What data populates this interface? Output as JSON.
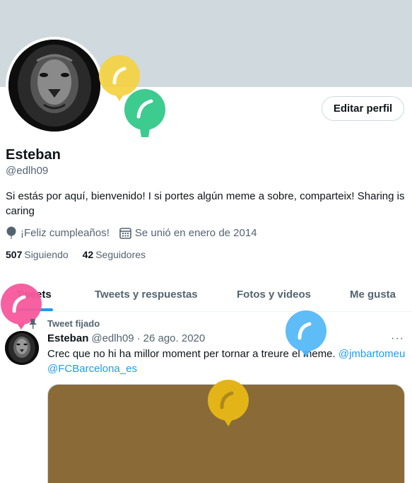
{
  "profile": {
    "name": "Esteban",
    "handle": "@edlh09",
    "bio": "Si estás por aquí, bienvenido! I si portes algún meme a sobre, comparteix! Sharing is caring",
    "birthday": "¡Feliz cumpleaños!",
    "joined": "Se unió en enero de 2014",
    "following_count": "507",
    "following_label": "Siguiendo",
    "followers_count": "42",
    "followers_label": "Seguidores",
    "edit_label": "Editar perfil"
  },
  "tabs": [
    {
      "label": "Tweets",
      "active": true
    },
    {
      "label": "Tweets y respuestas",
      "active": false
    },
    {
      "label": "Fotos y videos",
      "active": false
    },
    {
      "label": "Me gusta",
      "active": false
    }
  ],
  "tweet": {
    "pinned_label": "Tweet fijado",
    "name": "Esteban",
    "handle": "@edlh09",
    "separator": "·",
    "date": "26 ago. 2020",
    "more": "···",
    "text": "Crec que no hi ha millor moment per tornar a treure el meme.",
    "mention1": "@jmbartomeu",
    "mention2": "@FCBarcelona_es"
  },
  "icons": {
    "birthday": "balloon-icon",
    "joined": "calendar-icon",
    "pinned": "pin-icon",
    "more": "more-icon"
  },
  "colors": {
    "accent": "#1d9bf0",
    "banner": "#cfd9de",
    "balloon_yellow": "#f5d13d",
    "balloon_green": "#3dcb8f",
    "balloon_pink": "#f7589c",
    "balloon_blue": "#4db5f5",
    "balloon_gold": "#e2b417",
    "media_color": "#8a6a37"
  }
}
